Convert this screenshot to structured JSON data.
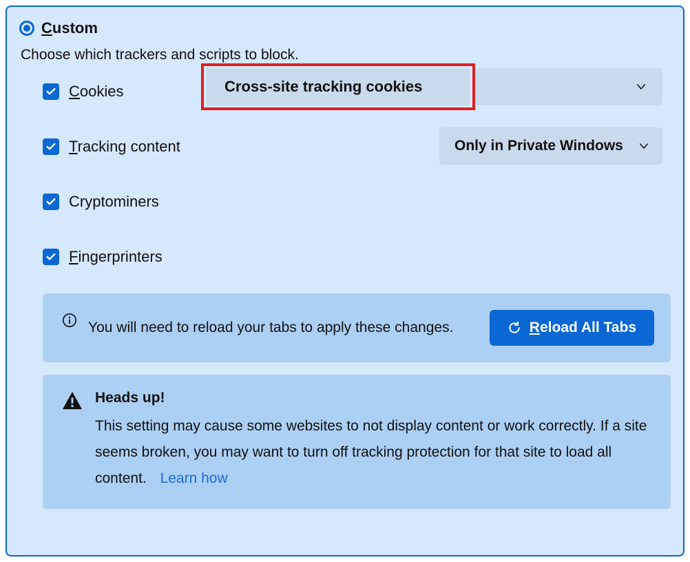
{
  "title_prefix": "C",
  "title_rest": "ustom",
  "description": "Choose which trackers and scripts to block.",
  "options": {
    "cookies": {
      "prefix": "C",
      "rest": "ookies",
      "checked": true,
      "dropdown_value": "Cross-site tracking cookies"
    },
    "tracking": {
      "prefix": "T",
      "rest": "racking content",
      "checked": true,
      "dropdown_value": "Only in Private Windows"
    },
    "cryptominers": {
      "label": "Cryptominers",
      "checked": true
    },
    "fingerprinters": {
      "prefix": "F",
      "rest": "ingerprinters",
      "checked": true
    }
  },
  "info": {
    "text": "You will need to reload your tabs to apply these changes.",
    "button_prefix": "R",
    "button_rest": "eload All Tabs"
  },
  "warning": {
    "title": "Heads up!",
    "text": "This setting may cause some websites to not display content or work correctly. If a site seems broken, you may want to turn off tracking protection for that site to load all content.",
    "link": "Learn how"
  },
  "colors": {
    "accent": "#0a67d3",
    "panel_bg": "#d6e8fb",
    "box_bg": "#accff4",
    "dropdown_bg": "#c9daec",
    "highlight_border": "#e02020"
  }
}
